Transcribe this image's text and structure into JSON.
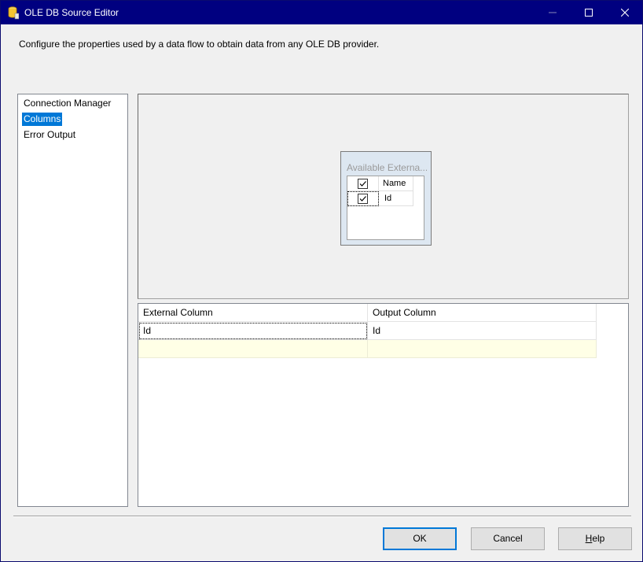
{
  "window": {
    "title": "OLE DB Source Editor"
  },
  "description": "Configure the properties used by a data flow to obtain data from any OLE DB provider.",
  "nav": {
    "items": [
      {
        "label": "Connection Manager",
        "selected": false
      },
      {
        "label": "Columns",
        "selected": true
      },
      {
        "label": "Error Output",
        "selected": false
      }
    ]
  },
  "available_columns": {
    "title": "Available Externa...",
    "header_name": "Name",
    "header_checked": true,
    "rows": [
      {
        "name": "Id",
        "checked": true
      }
    ]
  },
  "mapping": {
    "headers": [
      "External Column",
      "Output Column"
    ],
    "rows": [
      {
        "external": "Id",
        "output": "Id"
      }
    ]
  },
  "buttons": {
    "ok": "OK",
    "cancel": "Cancel",
    "help_underlined": "H",
    "help_rest": "elp"
  },
  "colors": {
    "titlebar": "#000080",
    "selection": "#0078d7",
    "new_row": "#ffffe6"
  }
}
